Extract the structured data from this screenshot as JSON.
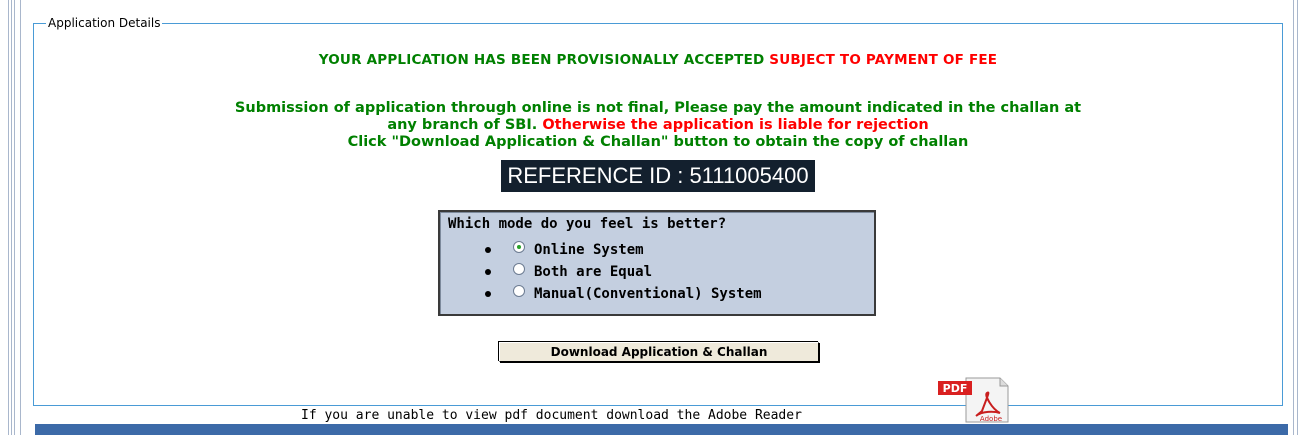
{
  "fieldset": {
    "legend": "Application Details"
  },
  "status": {
    "accepted_text": "YOUR APPLICATION HAS BEEN PROVISIONALLY ACCEPTED",
    "payment_text": "SUBJECT TO PAYMENT OF FEE"
  },
  "instructions": {
    "line1": "Submission of application through online is not final, Please pay the amount indicated in the challan at",
    "line2_green": "any branch of SBI.",
    "line2_red": "Otherwise the application is liable for rejection",
    "line3": "Click \"Download Application & Challan\" button to obtain the copy of challan"
  },
  "reference": {
    "text": "REFERENCE ID : 5111005400"
  },
  "poll": {
    "question": "Which mode do you feel is better?",
    "options": [
      {
        "label": "Online System",
        "selected": true
      },
      {
        "label": "Both are Equal",
        "selected": false
      },
      {
        "label": "Manual(Conventional) System",
        "selected": false
      }
    ]
  },
  "download_button": {
    "label": "Download Application & Challan"
  },
  "footnote": {
    "text": "If you are unable to view pdf document download the Adobe Reader"
  },
  "pdf_icon": {
    "name": "pdf-icon",
    "badge": "PDF",
    "caption": "Adobe"
  },
  "colors": {
    "green": "#008000",
    "red": "#ff0000",
    "reference_bg": "#13202e",
    "poll_bg": "#c4cfe0",
    "border_blue": "#4a9bd6",
    "bottom_bar": "#3c6aa8"
  }
}
